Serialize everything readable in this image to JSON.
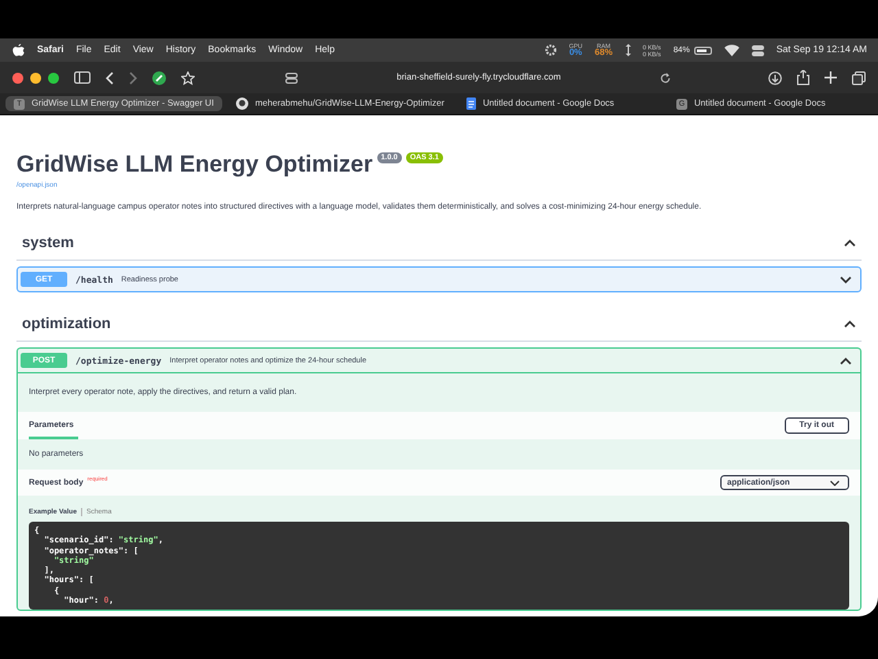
{
  "menu_bar": {
    "app": "Safari",
    "items": [
      "File",
      "Edit",
      "View",
      "History",
      "Bookmarks",
      "Window",
      "Help"
    ],
    "status": [
      {
        "label": "GPU",
        "value": "0%",
        "color": "#3a8ee6"
      },
      {
        "label": "RAM",
        "value": "68%",
        "color": "#e08a2c"
      }
    ],
    "network": [
      "0 KB/s",
      "0 KB/s"
    ],
    "battery": "84%",
    "clock": "Sat Sep 19  12:14 AM"
  },
  "toolbar": {
    "address": "brian-sheffield-surely-fly.trycloudflare.com"
  },
  "tabs": [
    {
      "label": "GridWise LLM Energy Optimizer - Swagger UI",
      "selected": true,
      "kind": "letter",
      "mark": "T"
    },
    {
      "label": "meherabmehu/GridWise-LLM-Energy-Optimizer",
      "selected": false,
      "kind": "github"
    },
    {
      "label": "Untitled document - Google Docs",
      "selected": false,
      "kind": "docs"
    },
    {
      "label": "Untitled document - Google Docs",
      "selected": false,
      "kind": "letter",
      "mark": "G"
    }
  ],
  "api": {
    "title": "GridWise LLM Energy Optimizer",
    "version": "1.0.0",
    "oas": "OAS 3.1",
    "spec_link": "/openapi.json",
    "description": "Interprets natural-language campus operator notes into structured directives with a language model, validates them deterministically, and solves a cost-minimizing 24-hour energy schedule."
  },
  "sections": [
    {
      "name": "system",
      "expanded": true,
      "operations": [
        {
          "method": "GET",
          "path": "/health",
          "summary": "Readiness probe",
          "expanded": false
        }
      ]
    },
    {
      "name": "optimization",
      "expanded": true,
      "operations": [
        {
          "method": "POST",
          "path": "/optimize-energy",
          "summary": "Interpret operator notes and optimize the 24-hour schedule",
          "expanded": true,
          "description": "Interpret every operator note, apply the directives, and return a valid plan.",
          "parameters_tab": "Parameters",
          "try_button": "Try it out",
          "no_params": "No parameters",
          "request_body": "Request body",
          "required": "required",
          "content_type": "application/json",
          "example_tabs": [
            {
              "label": "Example Value",
              "selected": true
            },
            {
              "label": "Schema",
              "selected": false
            }
          ],
          "code": [
            [
              {
                "t": "{",
                "kind": "punct"
              }
            ],
            [
              {
                "t": "  \"scenario_id\"",
                "kind": "key"
              },
              {
                "t": ": ",
                "kind": "punct"
              },
              {
                "t": "\"string\"",
                "kind": "string"
              },
              {
                "t": ",",
                "kind": "punct"
              }
            ],
            [
              {
                "t": "  \"operator_notes\"",
                "kind": "key"
              },
              {
                "t": ": [",
                "kind": "punct"
              }
            ],
            [
              {
                "t": "    \"string\"",
                "kind": "string"
              }
            ],
            [
              {
                "t": "  ],",
                "kind": "punct"
              }
            ],
            [
              {
                "t": "  \"hours\"",
                "kind": "key"
              },
              {
                "t": ": [",
                "kind": "punct"
              }
            ],
            [
              {
                "t": "    {",
                "kind": "punct"
              }
            ],
            [
              {
                "t": "      \"hour\"",
                "kind": "key"
              },
              {
                "t": ": ",
                "kind": "punct"
              },
              {
                "t": "0",
                "kind": "number"
              },
              {
                "t": ",",
                "kind": "punct"
              }
            ]
          ]
        }
      ]
    }
  ]
}
